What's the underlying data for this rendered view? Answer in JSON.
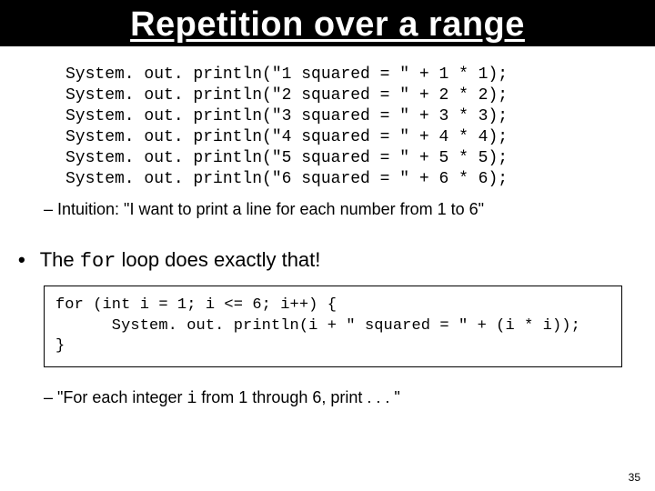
{
  "title": "Repetition over a range",
  "code1": "System. out. println(\"1 squared = \" + 1 * 1);\nSystem. out. println(\"2 squared = \" + 2 * 2);\nSystem. out. println(\"3 squared = \" + 3 * 3);\nSystem. out. println(\"4 squared = \" + 4 * 4);\nSystem. out. println(\"5 squared = \" + 5 * 5);\nSystem. out. println(\"6 squared = \" + 6 * 6);",
  "intuition_prefix": "– Intuition: \"I want to print a line for each number from 1 to 6\"",
  "main_prefix": "The ",
  "main_code": "for",
  "main_suffix": " loop does exactly that!",
  "code2": "for (int i = 1; i <= 6; i++) {\n      System. out. println(i + \" squared = \" + (i * i));\n}",
  "sub_prefix": "– \"For each integer ",
  "sub_i": "i",
  "sub_suffix": " from 1 through 6, print . . . \"",
  "page": "35"
}
